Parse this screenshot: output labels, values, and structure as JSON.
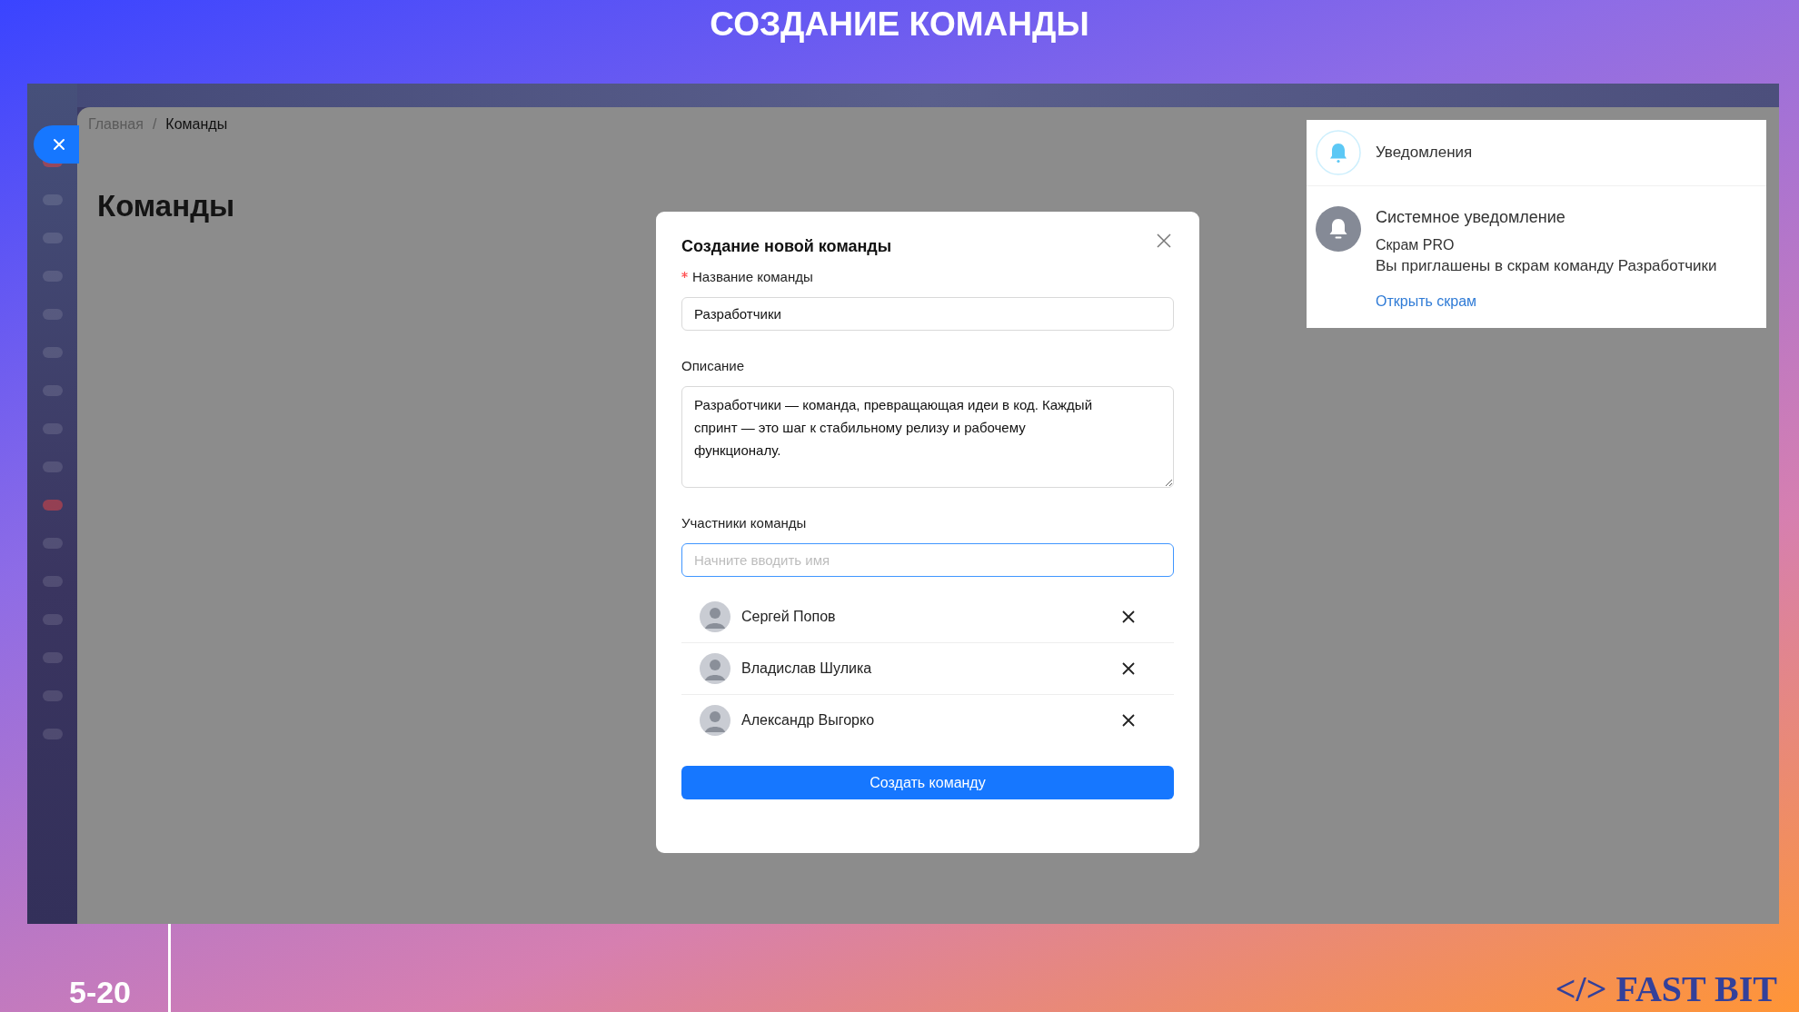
{
  "slide": {
    "title": "СОЗДАНИЕ КОМАНДЫ",
    "page_number": "5-20",
    "logo": "</> FAST BIT"
  },
  "app": {
    "breadcrumb": {
      "separator": "/",
      "items": [
        {
          "label": "Главная",
          "current": false
        },
        {
          "label": "Команды",
          "current": true
        }
      ]
    },
    "page_title": "Команды"
  },
  "modal": {
    "title": "Создание новой команды",
    "fields": [
      {
        "kind": "input",
        "label": "Название команды",
        "required": true,
        "value": "Разработчики",
        "focused": false
      },
      {
        "kind": "textarea",
        "label": "Описание",
        "required": false,
        "value": "Разработчики — команда, превращающая идеи в код. Каждый спринт — это шаг к стабильному релизу и рабочему функционалу.",
        "focused": false
      },
      {
        "kind": "input",
        "label": "Участники команды",
        "required": false,
        "placeholder": "Начните вводить имя",
        "focused": true
      }
    ],
    "members": [
      {
        "name": "Сергей Попов"
      },
      {
        "name": "Владислав Шулика"
      },
      {
        "name": "Александр Выгорко"
      }
    ],
    "submit": "Создать команду"
  },
  "notifications": {
    "title": "Уведомления",
    "items": [
      {
        "title": "Системное уведомление",
        "source": "Скрам PRO",
        "message": "Вы приглашены в скрам команду Разработчики",
        "link": "Открыть скрам"
      }
    ]
  }
}
